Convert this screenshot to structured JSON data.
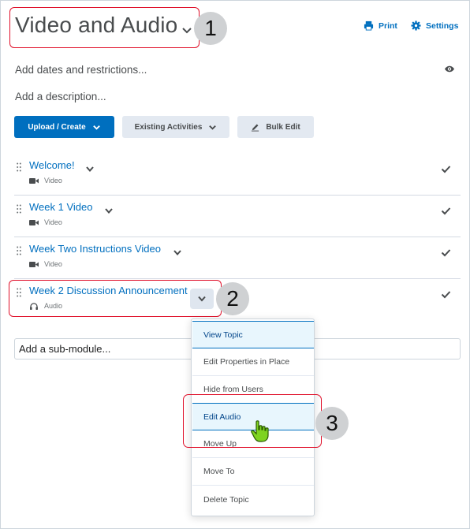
{
  "header": {
    "title": "Video and Audio",
    "print_label": "Print",
    "settings_label": "Settings"
  },
  "callouts": [
    "1",
    "2",
    "3"
  ],
  "meta": {
    "dates_label": "Add dates and restrictions...",
    "description_label": "Add a description..."
  },
  "toolbar": {
    "upload_label": "Upload / Create",
    "existing_label": "Existing Activities",
    "bulk_label": "Bulk Edit"
  },
  "topics": [
    {
      "title": "Welcome!",
      "type": "Video",
      "icon": "video-camera-icon"
    },
    {
      "title": "Week 1 Video",
      "type": "Video",
      "icon": "video-camera-icon"
    },
    {
      "title": "Week Two Instructions Video",
      "type": "Video",
      "icon": "video-camera-icon"
    },
    {
      "title": "Week 2 Discussion Announcement",
      "type": "Audio",
      "icon": "headphones-icon"
    }
  ],
  "submodule_placeholder": "Add a sub-module...",
  "context_menu": {
    "items": [
      "View Topic",
      "Edit Properties in Place",
      "Hide from Users",
      "Edit Audio",
      "Move Up",
      "Move To",
      "Delete Topic"
    ],
    "active_items": [
      "View Topic",
      "Edit Audio"
    ]
  },
  "colors": {
    "link": "#006fbf",
    "primary_button": "#006fbf",
    "callout_border": "#e0102a",
    "callout_badge": "#cfd1d3"
  }
}
